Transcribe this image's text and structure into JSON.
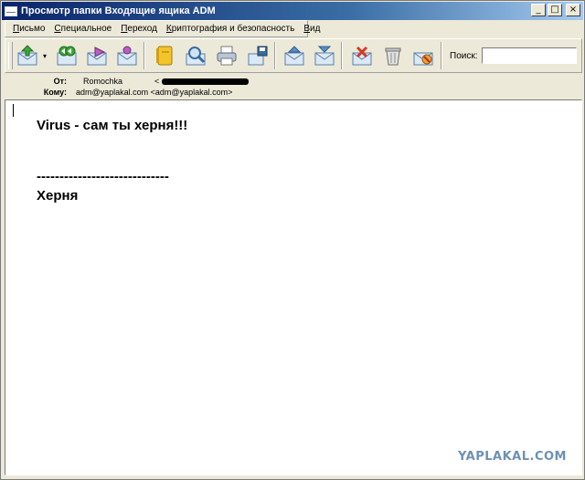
{
  "window": {
    "title": "Просмотр папки Входящие ящика ADM",
    "buttons": {
      "minimize": "_",
      "maximize": "□",
      "close": "×"
    }
  },
  "menu": [
    {
      "accel": "П",
      "rest": "исьмо"
    },
    {
      "accel": "С",
      "rest": "пециальное"
    },
    {
      "accel": "П",
      "rest": "ереход"
    },
    {
      "accel": "К",
      "rest": "риптография и безопасность"
    },
    {
      "accel": "В",
      "rest": "ид"
    }
  ],
  "toolbar": {
    "icons": [
      "get-mail-icon",
      "dropdown-arrow-icon",
      "reply-all-icon",
      "forward-icon",
      "new-message-icon",
      "address-book-icon",
      "find-icon",
      "print-icon",
      "save-icon",
      "previous-message-icon",
      "next-message-icon",
      "delete-icon",
      "trash-icon",
      "junk-icon"
    ],
    "dropdown_glyph": "▾",
    "search_label": "Поиск:",
    "search_value": ""
  },
  "header": {
    "from_label": "От:",
    "from_name": "Romochka",
    "from_bracket": "<",
    "to_label": "Кому:",
    "to_value": "adm@yaplakal.com <adm@yaplakal.com>"
  },
  "message": {
    "line1": "Virus - сам ты херня!!!",
    "separator": "-----------------------------",
    "line2": "Херня"
  },
  "watermark": "YAPLAKAL.COM",
  "colors": {
    "title_start": "#0a246a",
    "title_end": "#a6caf0",
    "watermark": "#6d90b5"
  }
}
